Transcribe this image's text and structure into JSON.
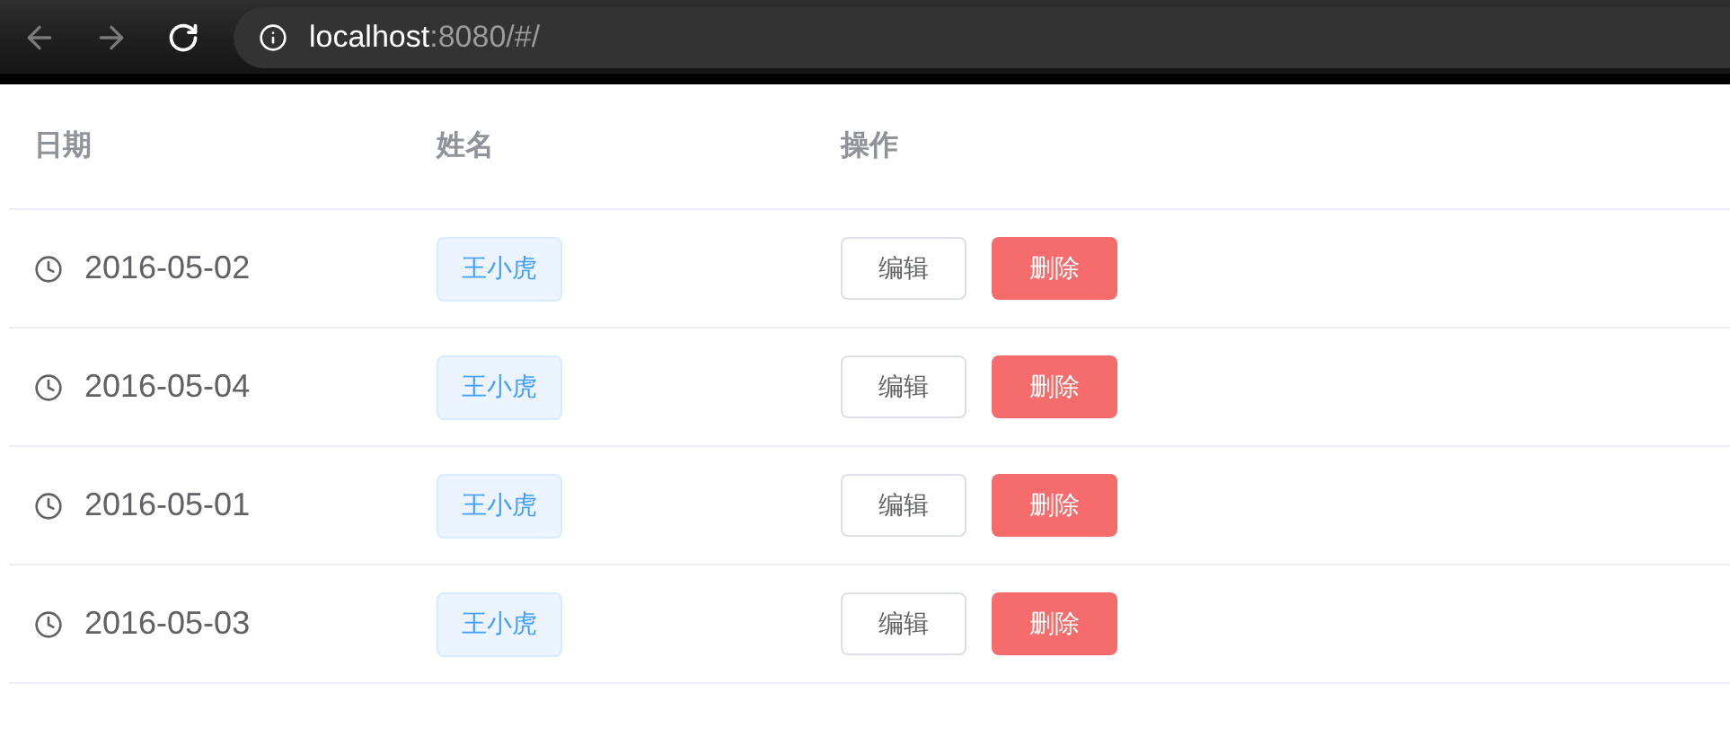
{
  "browser": {
    "url_host": "localhost",
    "url_path": ":8080/#/"
  },
  "table": {
    "columns": [
      "日期",
      "姓名",
      "操作"
    ],
    "rows": [
      {
        "date": "2016-05-02",
        "name": "王小虎",
        "actions": [
          "编辑",
          "删除"
        ]
      },
      {
        "date": "2016-05-04",
        "name": "王小虎",
        "actions": [
          "编辑",
          "删除"
        ]
      },
      {
        "date": "2016-05-01",
        "name": "王小虎",
        "actions": [
          "编辑",
          "删除"
        ]
      },
      {
        "date": "2016-05-03",
        "name": "王小虎",
        "actions": [
          "编辑",
          "删除"
        ]
      }
    ]
  }
}
